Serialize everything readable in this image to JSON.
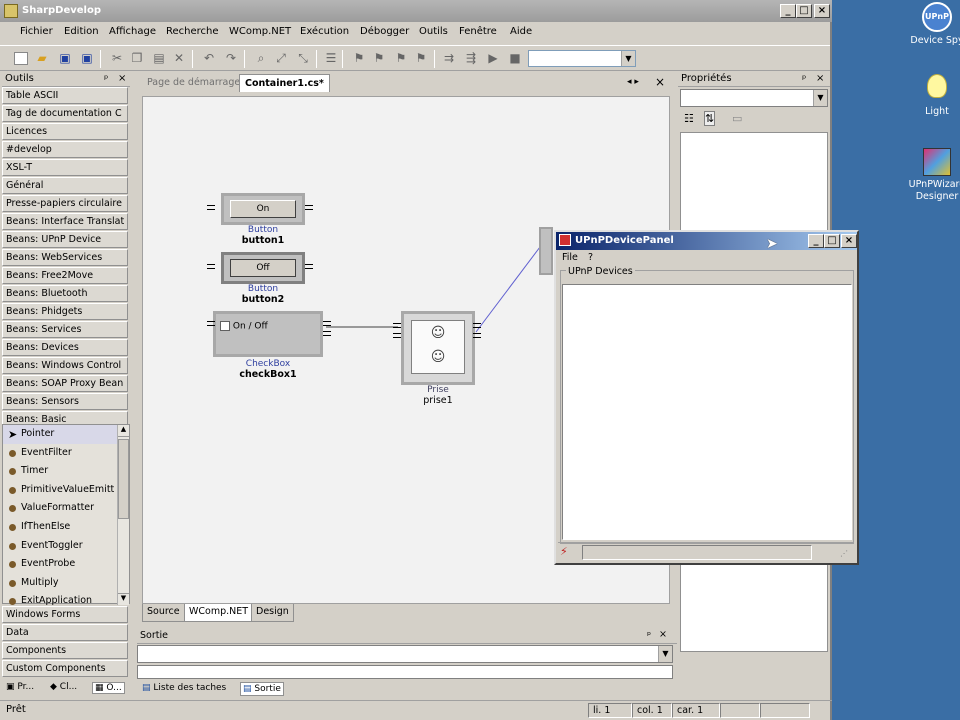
{
  "window": {
    "title": "SharpDevelop"
  },
  "menu": [
    "Fichier",
    "Edition",
    "Affichage",
    "Recherche",
    "WComp.NET",
    "Exécution",
    "Débogger",
    "Outils",
    "Fenêtre",
    "Aide"
  ],
  "tools_panel": {
    "title": "Outils",
    "categories": [
      "Table ASCII",
      "Tag de documentation C",
      "Licences",
      "#develop",
      "XSL-T",
      "Général",
      "Presse-papiers circulaire",
      "Beans: Interface Translat",
      "Beans: UPnP Device",
      "Beans: WebServices",
      "Beans: Free2Move",
      "Beans: Bluetooth",
      "Beans: Phidgets",
      "Beans: Services",
      "Beans: Devices",
      "Beans: Windows Control",
      "Beans: SOAP Proxy Bean",
      "Beans: Sensors",
      "Beans: Basic"
    ],
    "items": [
      "Pointer",
      "EventFilter",
      "Timer",
      "PrimitiveValueEmitt",
      "ValueFormatter",
      "IfThenElse",
      "EventToggler",
      "EventProbe",
      "Multiply",
      "ExitApplication"
    ],
    "bottom_categories": [
      "Windows Forms",
      "Data",
      "Components",
      "Custom Components"
    ],
    "bottom_tabs": [
      "Pr...",
      "Cl...",
      "O..."
    ]
  },
  "doc_tabs": [
    "Page de démarrage",
    "Container1.cs*"
  ],
  "components": {
    "button1": {
      "face": "On",
      "type": "Button",
      "name": "button1"
    },
    "button2": {
      "face": "Off",
      "type": "Button",
      "name": "button2"
    },
    "checkbox1": {
      "face": "On / Off",
      "type": "CheckBox",
      "name": "checkBox1"
    },
    "prise1": {
      "type": "Prise",
      "name": "prise1"
    }
  },
  "view_tabs": [
    "Source",
    "WComp.NET",
    "Design"
  ],
  "output": {
    "title": "Sortie",
    "tabs": [
      "Liste des taches",
      "Sortie"
    ]
  },
  "properties": {
    "title": "Propriétés"
  },
  "status": {
    "left": "Prêt",
    "line": "li. 1",
    "col": "col. 1",
    "car": "car. 1"
  },
  "upnp_window": {
    "title": "UPnPDevicePanel",
    "menu": [
      "File",
      "?"
    ],
    "group": "UPnP Devices"
  },
  "desktop_icons": [
    {
      "label": "Device Spy"
    },
    {
      "label": "Light"
    },
    {
      "label": "UPnPWizard Designer"
    }
  ]
}
